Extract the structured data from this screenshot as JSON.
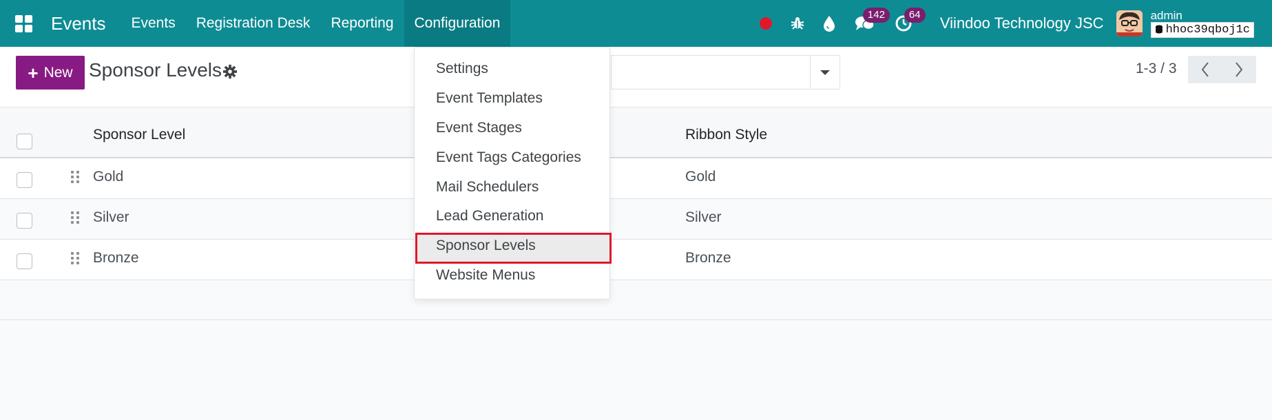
{
  "navbar": {
    "app_name": "Events",
    "menu": [
      "Events",
      "Registration Desk",
      "Reporting",
      "Configuration"
    ],
    "active_menu": "Configuration",
    "messages_count": "142",
    "activities_count": "64",
    "company": "Viindoo Technology JSC",
    "user": "admin",
    "database": "hhoc39qboj1c"
  },
  "control": {
    "new_label": "New",
    "title": "Sponsor Levels",
    "pager": "1-3 / 3"
  },
  "list": {
    "columns": [
      "Sponsor Level",
      "Ribbon Style"
    ],
    "rows": [
      {
        "level": "Gold",
        "ribbon": "Gold"
      },
      {
        "level": "Silver",
        "ribbon": "Silver"
      },
      {
        "level": "Bronze",
        "ribbon": "Bronze"
      }
    ]
  },
  "dropdown": {
    "items": [
      "Settings",
      "Event Templates",
      "Event Stages",
      "Event Tags Categories",
      "Mail Schedulers",
      "Lead Generation",
      "Sponsor Levels",
      "Website Menus"
    ],
    "highlighted": "Sponsor Levels"
  },
  "colors": {
    "navbar": "#0e8c94",
    "primary_button": "#881b83",
    "highlight_border": "#e0182c"
  }
}
